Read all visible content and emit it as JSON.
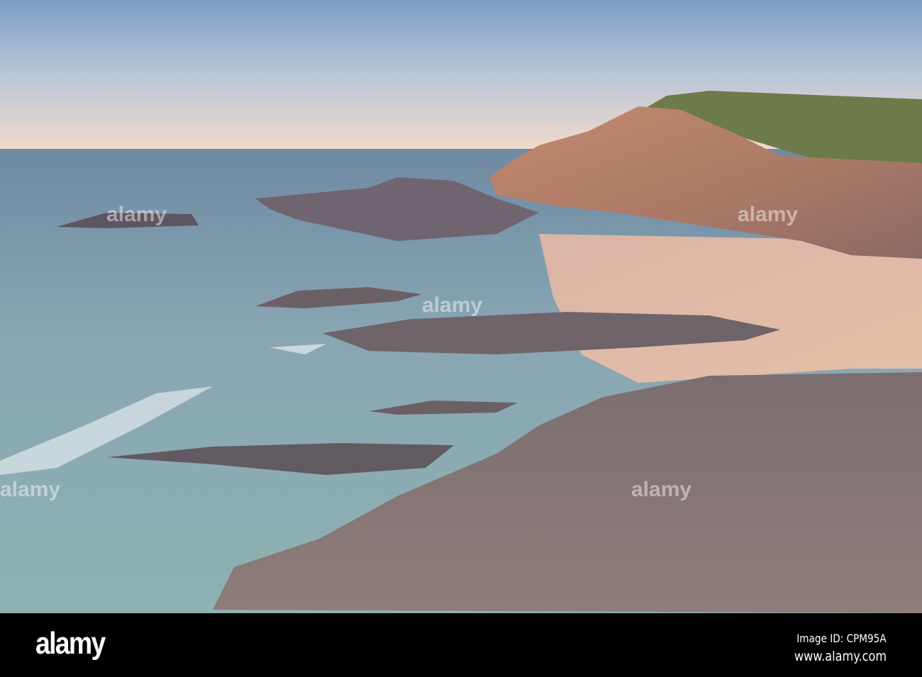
{
  "photo": {
    "subject": "rocky coastline with cliffs and sandy beach at sunset"
  },
  "footer": {
    "logo": "alamy",
    "image_id": "Image ID: CPM95A",
    "website": "www.alamy.com"
  },
  "watermark": "alamy"
}
